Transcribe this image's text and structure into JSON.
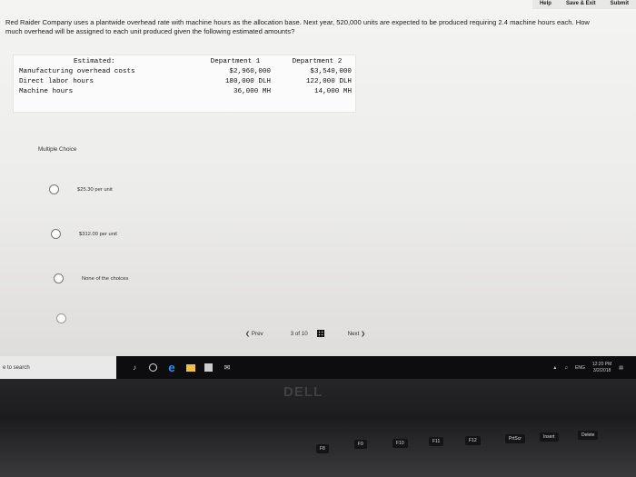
{
  "topbar": {
    "help": "Help",
    "save_exit": "Save & Exit",
    "submit": "Submit"
  },
  "question": {
    "text": "Red Raider Company uses a plantwide overhead rate with machine hours as the allocation base. Next year, 520,000 units are expected to be produced requiring 2.4 machine hours each. How much overhead will be assigned to each unit produced given the following estimated amounts?"
  },
  "estimates": {
    "header_label": "Estimated:",
    "rows": [
      "Manufacturing overhead costs",
      "Direct labor hours",
      "Machine hours"
    ],
    "dept1": {
      "header": "Department 1",
      "values": [
        "$2,960,000",
        "180,000 DLH",
        "36,000 MH"
      ]
    },
    "dept2": {
      "header": "Department 2",
      "values": [
        "$3,540,000",
        "122,000 DLH",
        "14,000 MH"
      ]
    }
  },
  "mc": {
    "label": "Multiple Choice",
    "options": [
      "$25.30 per unit",
      "$312.00 per unit",
      "None of the choices"
    ]
  },
  "pager": {
    "prev": "Prev",
    "current": "3",
    "of": "of",
    "total": "10",
    "next": "Next"
  },
  "taskbar": {
    "search_placeholder": "e to search",
    "time": "12:20 PM",
    "date": "3/2/2018",
    "lang": "ENG"
  },
  "laptop": {
    "brand": "DELL",
    "keys": [
      "F8",
      "F9",
      "F10",
      "F11",
      "F12",
      "PrtScr",
      "Insert",
      "Delete"
    ]
  }
}
